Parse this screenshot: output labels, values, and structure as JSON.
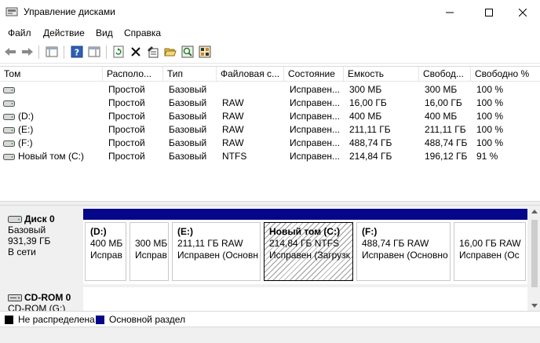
{
  "window": {
    "title": "Управление дисками",
    "controls": [
      "minimize-icon",
      "maximize-icon",
      "close-icon"
    ]
  },
  "menu": {
    "items": [
      "Файл",
      "Действие",
      "Вид",
      "Справка"
    ]
  },
  "toolbar": {
    "icons": [
      "back-arrow-icon",
      "forward-arrow-icon",
      "console-tree-icon",
      "help-icon",
      "action-pane-icon",
      "refresh-icon",
      "delete-icon",
      "properties-icon",
      "open-folder-icon",
      "search-icon",
      "rescan-disks-icon"
    ]
  },
  "volume_list": {
    "columns": [
      "Том",
      "Располо...",
      "Тип",
      "Файловая с...",
      "Состояние",
      "Емкость",
      "Свобод...",
      "Свободно %"
    ],
    "rows": [
      {
        "tom": "",
        "layout": "Простой",
        "type": "Базовый",
        "fs": "",
        "status": "Исправен...",
        "capacity": "300 МБ",
        "free": "300 МБ",
        "free_pct": "100 %"
      },
      {
        "tom": "",
        "layout": "Простой",
        "type": "Базовый",
        "fs": "RAW",
        "status": "Исправен...",
        "capacity": "16,00 ГБ",
        "free": "16,00 ГБ",
        "free_pct": "100 %"
      },
      {
        "tom": "(D:)",
        "layout": "Простой",
        "type": "Базовый",
        "fs": "RAW",
        "status": "Исправен...",
        "capacity": "400 МБ",
        "free": "400 МБ",
        "free_pct": "100 %"
      },
      {
        "tom": "(E:)",
        "layout": "Простой",
        "type": "Базовый",
        "fs": "RAW",
        "status": "Исправен...",
        "capacity": "211,11 ГБ",
        "free": "211,11 ГБ",
        "free_pct": "100 %"
      },
      {
        "tom": "(F:)",
        "layout": "Простой",
        "type": "Базовый",
        "fs": "RAW",
        "status": "Исправен...",
        "capacity": "488,74 ГБ",
        "free": "488,74 ГБ",
        "free_pct": "100 %"
      },
      {
        "tom": "Новый том (C:)",
        "layout": "Простой",
        "type": "Базовый",
        "fs": "NTFS",
        "status": "Исправен...",
        "capacity": "214,84 ГБ",
        "free": "196,12 ГБ",
        "free_pct": "91 %"
      }
    ]
  },
  "disk0": {
    "name": "Диск 0",
    "type": "Базовый",
    "size": "931,39 ГБ",
    "status": "В сети",
    "partitions": [
      {
        "name": "(D:)",
        "line1": "400 МБ",
        "line2": "Исправ"
      },
      {
        "name": "",
        "line1": "300 МБ",
        "line2": "Исправ"
      },
      {
        "name": "(E:)",
        "line1": "211,11 ГБ RAW",
        "line2": "Исправен (Основн"
      },
      {
        "name": "Новый том  (C:)",
        "line1": "214,84 ГБ NTFS",
        "line2": "Исправен (Загрузк"
      },
      {
        "name": "(F:)",
        "line1": "488,74 ГБ RAW",
        "line2": "Исправен (Основно"
      },
      {
        "name": "",
        "line1": "16,00 ГБ RAW",
        "line2": "Исправен (Ос"
      }
    ]
  },
  "cdrom": {
    "name": "CD-ROM 0",
    "line2": "CD-ROM (G:)"
  },
  "legend": {
    "unallocated": "Не распределена",
    "primary": "Основной раздел"
  },
  "colors": {
    "primary_partition": "#06068a",
    "unallocated": "#000000"
  }
}
